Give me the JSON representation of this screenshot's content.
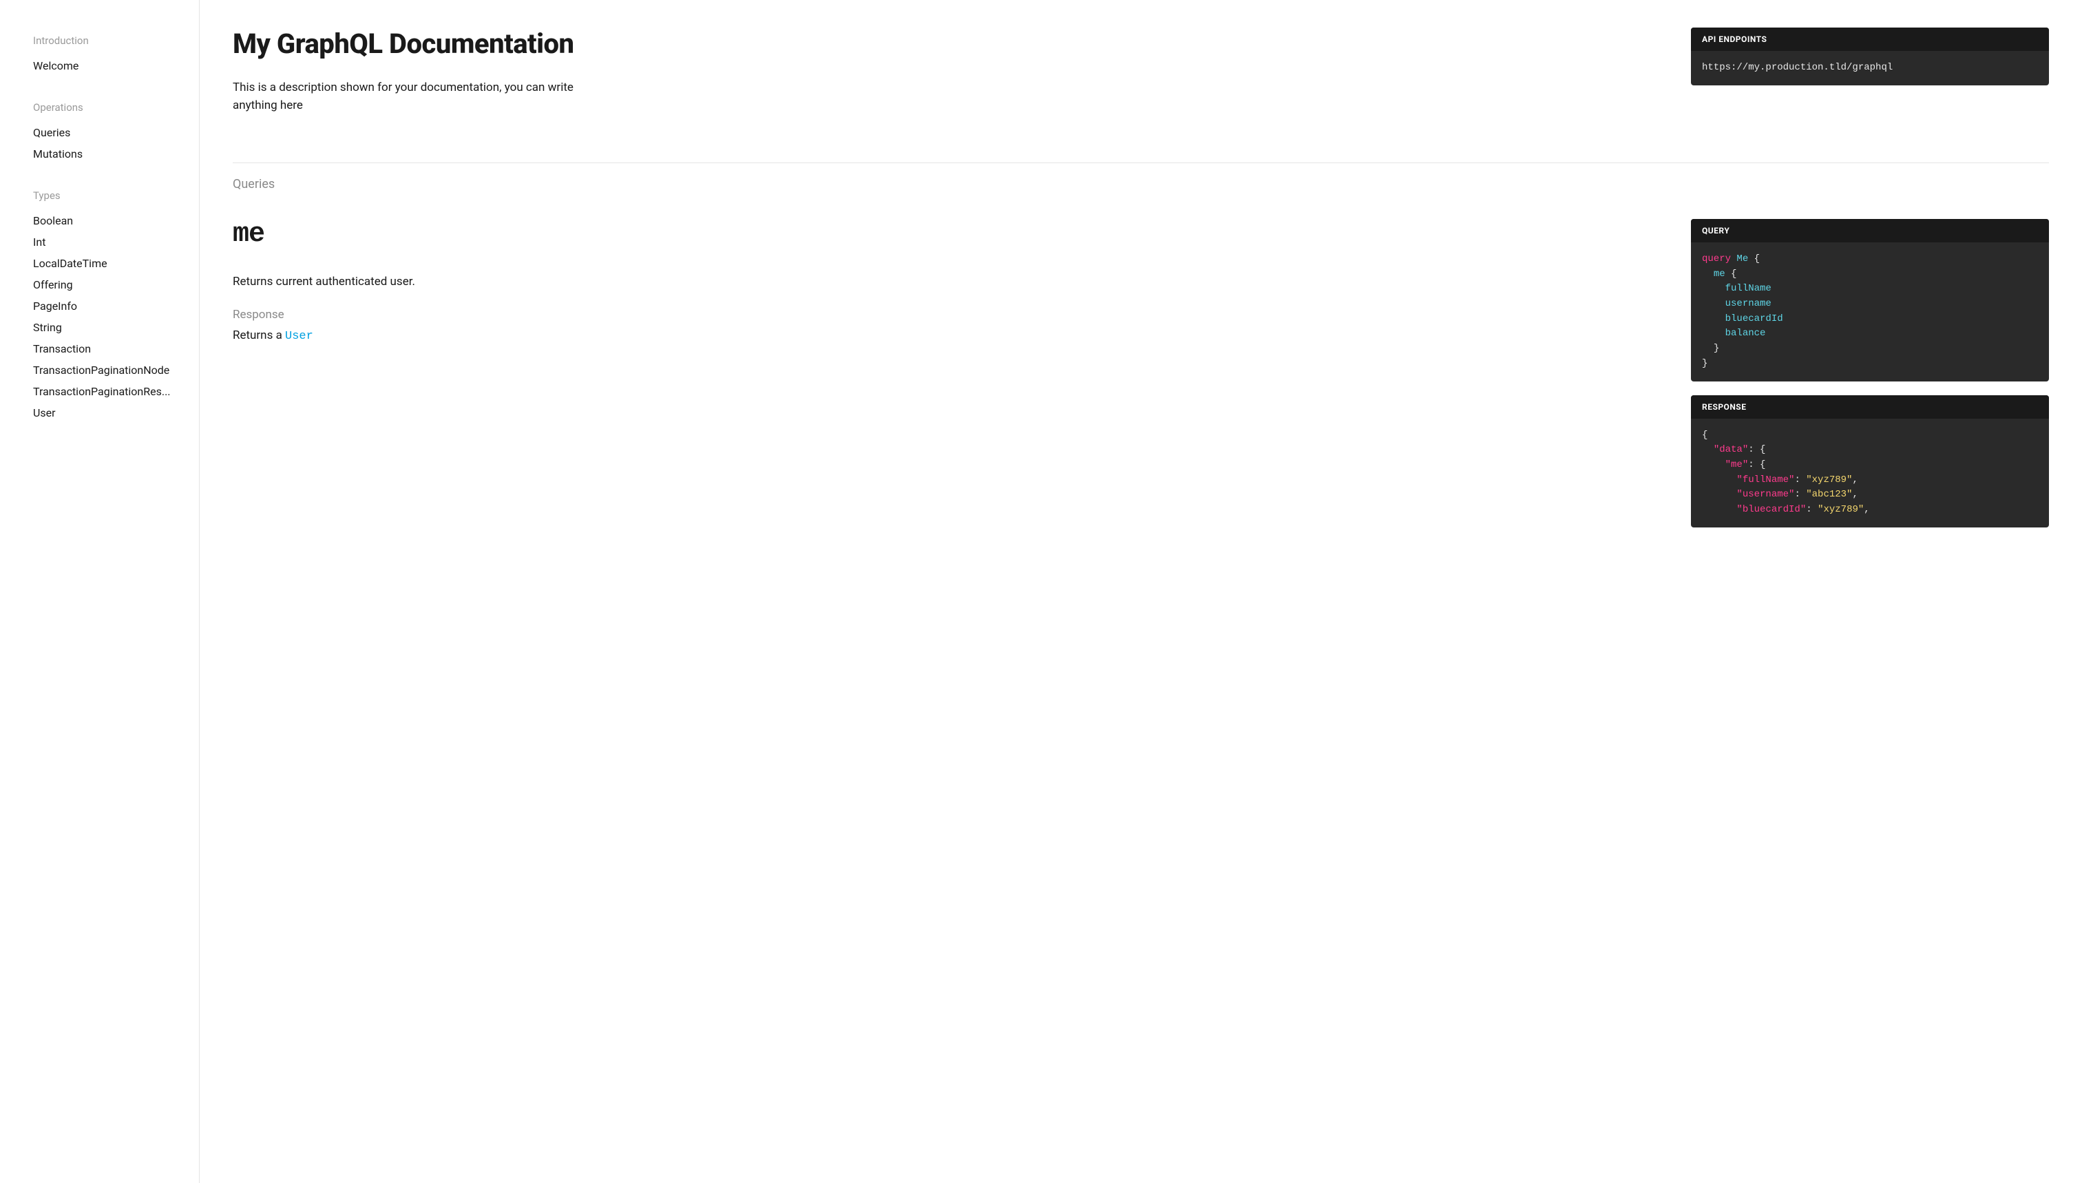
{
  "sidebar": {
    "sections": [
      {
        "heading": "Introduction",
        "items": [
          "Welcome"
        ]
      },
      {
        "heading": "Operations",
        "items": [
          "Queries",
          "Mutations"
        ]
      },
      {
        "heading": "Types",
        "items": [
          "Boolean",
          "Int",
          "LocalDateTime",
          "Offering",
          "PageInfo",
          "String",
          "Transaction",
          "TransactionPaginationNode",
          "TransactionPaginationRes...",
          "User"
        ]
      }
    ]
  },
  "header": {
    "title": "My GraphQL Documentation",
    "description": "This is a description shown for your documentation, you can write anything here"
  },
  "endpoint_panel": {
    "label": "API ENDPOINTS",
    "url": "https://my.production.tld/graphql"
  },
  "section_label": "Queries",
  "operation": {
    "name": "me",
    "description": "Returns current authenticated user.",
    "response_label": "Response",
    "returns_prefix": "Returns a ",
    "returns_type": "User"
  },
  "query_panel": {
    "label": "QUERY",
    "tokens": [
      [
        "kw",
        "query"
      ],
      [
        "sp",
        " "
      ],
      [
        "name",
        "Me"
      ],
      [
        "sp",
        " "
      ],
      [
        "brace",
        "{"
      ],
      [
        "nl"
      ],
      [
        "sp",
        "  "
      ],
      [
        "field",
        "me"
      ],
      [
        "sp",
        " "
      ],
      [
        "brace",
        "{"
      ],
      [
        "nl"
      ],
      [
        "sp",
        "    "
      ],
      [
        "field",
        "fullName"
      ],
      [
        "nl"
      ],
      [
        "sp",
        "    "
      ],
      [
        "field",
        "username"
      ],
      [
        "nl"
      ],
      [
        "sp",
        "    "
      ],
      [
        "field",
        "bluecardId"
      ],
      [
        "nl"
      ],
      [
        "sp",
        "    "
      ],
      [
        "field",
        "balance"
      ],
      [
        "nl"
      ],
      [
        "sp",
        "  "
      ],
      [
        "brace",
        "}"
      ],
      [
        "nl"
      ],
      [
        "brace",
        "}"
      ]
    ]
  },
  "response_panel": {
    "label": "RESPONSE",
    "tokens": [
      [
        "brace",
        "{"
      ],
      [
        "nl"
      ],
      [
        "sp",
        "  "
      ],
      [
        "key",
        "\"data\""
      ],
      [
        "punct",
        ": "
      ],
      [
        "brace",
        "{"
      ],
      [
        "nl"
      ],
      [
        "sp",
        "    "
      ],
      [
        "key",
        "\"me\""
      ],
      [
        "punct",
        ": "
      ],
      [
        "brace",
        "{"
      ],
      [
        "nl"
      ],
      [
        "sp",
        "      "
      ],
      [
        "key",
        "\"fullName\""
      ],
      [
        "punct",
        ": "
      ],
      [
        "str",
        "\"xyz789\""
      ],
      [
        "punct",
        ","
      ],
      [
        "nl"
      ],
      [
        "sp",
        "      "
      ],
      [
        "key",
        "\"username\""
      ],
      [
        "punct",
        ": "
      ],
      [
        "str",
        "\"abc123\""
      ],
      [
        "punct",
        ","
      ],
      [
        "nl"
      ],
      [
        "sp",
        "      "
      ],
      [
        "key",
        "\"bluecardId\""
      ],
      [
        "punct",
        ": "
      ],
      [
        "str",
        "\"xyz789\""
      ],
      [
        "punct",
        ","
      ]
    ]
  }
}
